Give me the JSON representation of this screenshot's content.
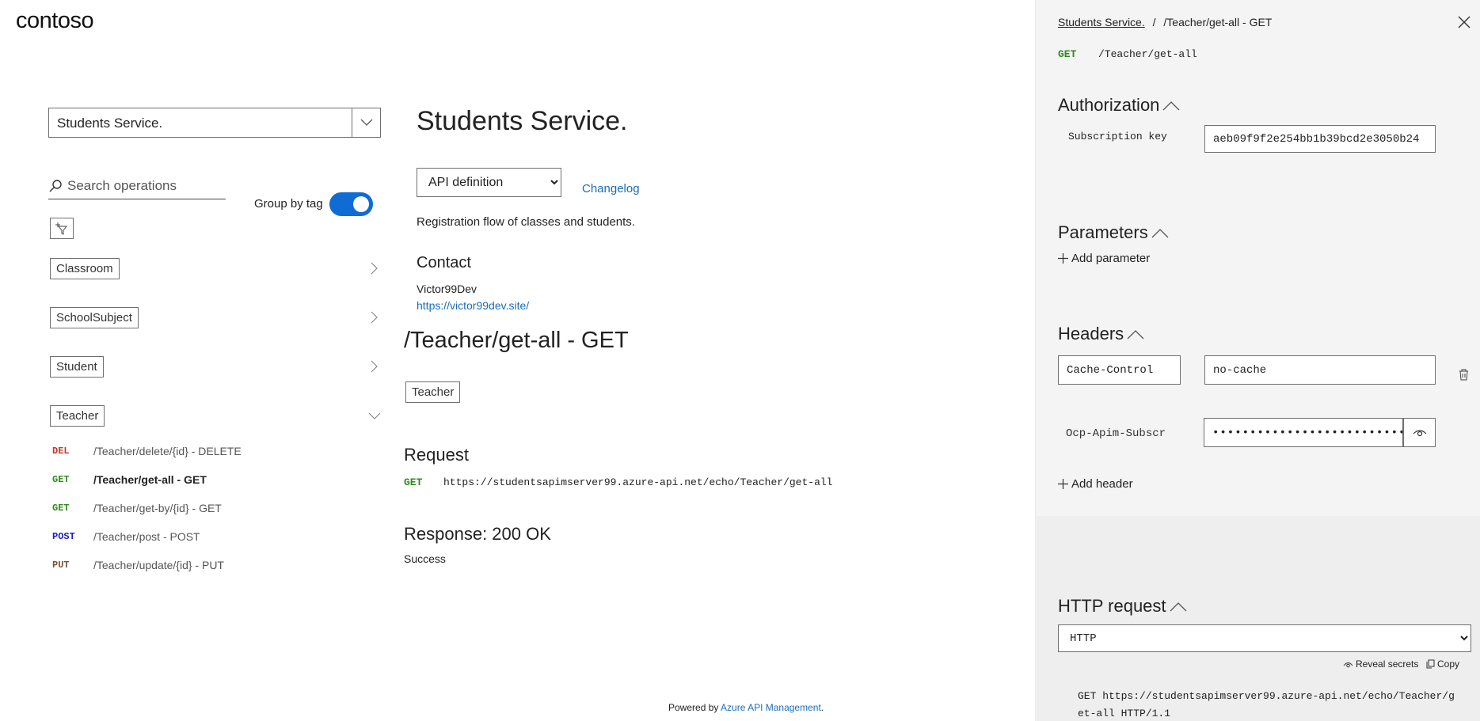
{
  "brand": {
    "logo": "contoso"
  },
  "sidebar": {
    "api_selected": "Students Service.",
    "search_placeholder": "Search operations",
    "group_by_tag_label": "Group by tag",
    "group_by_tag_on": true,
    "tags": [
      {
        "label": "Classroom",
        "expanded": false
      },
      {
        "label": "SchoolSubject",
        "expanded": false
      },
      {
        "label": "Student",
        "expanded": false
      },
      {
        "label": "Teacher",
        "expanded": true
      }
    ],
    "operations": [
      {
        "method": "DEL",
        "path": "/Teacher/delete/{id} - DELETE",
        "active": false
      },
      {
        "method": "GET",
        "path": "/Teacher/get-all - GET",
        "active": true
      },
      {
        "method": "GET",
        "path": "/Teacher/get-by/{id} - GET",
        "active": false
      },
      {
        "method": "POST",
        "path": "/Teacher/post - POST",
        "active": false
      },
      {
        "method": "PUT",
        "path": "/Teacher/update/{id} - PUT",
        "active": false
      }
    ]
  },
  "main": {
    "title": "Students Service.",
    "definition_selected": "API definition",
    "changelog_label": "Changelog",
    "description": "Registration flow of classes and students.",
    "contact_heading": "Contact",
    "contact_name": "Victor99Dev",
    "contact_url": "https://victor99dev.site/",
    "operation_title": "/Teacher/get-all - GET",
    "operation_tag": "Teacher",
    "request_heading": "Request",
    "request_method": "GET",
    "request_url": "https://studentsapimserver99.azure-api.net/echo/Teacher/get-all",
    "response_heading": "Response: 200 OK",
    "response_desc": "Success",
    "footer_prefix": "Powered by ",
    "footer_link": "Azure API Management",
    "footer_suffix": "."
  },
  "panel": {
    "breadcrumb_root": "Students Service.",
    "breadcrumb_sep": "/",
    "breadcrumb_current": "/Teacher/get-all - GET",
    "method": "GET",
    "path": "/Teacher/get-all",
    "authorization_heading": "Authorization",
    "subscription_key_label": "Subscription key",
    "subscription_key_value": "aeb09f9f2e254bb1b39bcd2e3050b24",
    "parameters_heading": "Parameters",
    "add_parameter_label": "Add parameter",
    "headers_heading": "Headers",
    "headers": [
      {
        "name": "Cache-Control",
        "value": "no-cache"
      },
      {
        "name": "Ocp-Apim-Subscr",
        "value": "••••••••••••••••••••••••••"
      }
    ],
    "add_header_label": "Add header",
    "http_request_heading": "HTTP request",
    "http_format_selected": "HTTP",
    "reveal_secrets_label": "Reveal secrets",
    "copy_label": "Copy",
    "code_line1": "GET https://studentsapimserver99.azure-api.net/echo/Teacher/g",
    "code_line2": "et-all HTTP/1.1"
  },
  "colors": {
    "accent": "#0f6cd4",
    "get": "#2e8b1e",
    "delete": "#c0392b",
    "post": "#1d1ac9",
    "put": "#7e5437",
    "link": "#1a6dbb"
  }
}
